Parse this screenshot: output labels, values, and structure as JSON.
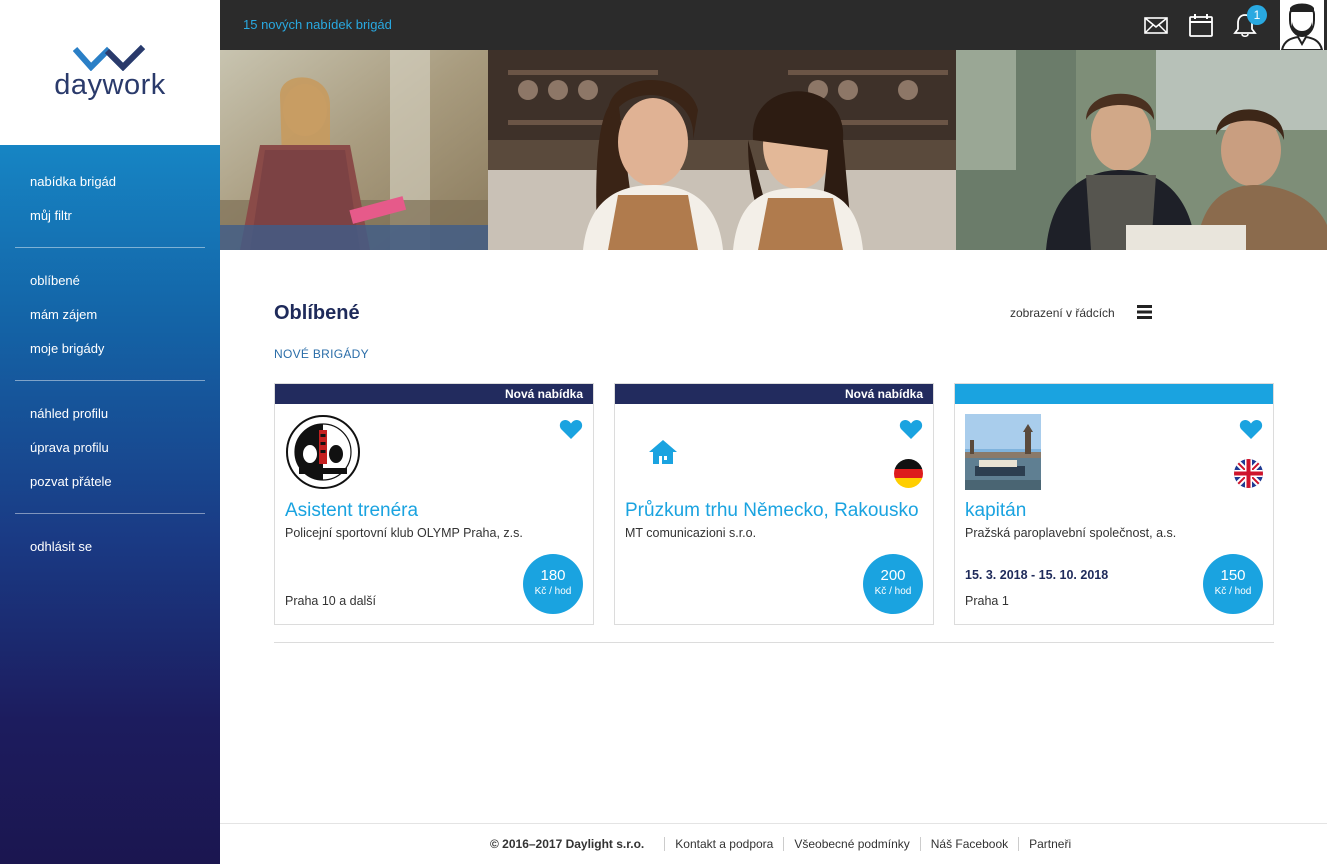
{
  "brand": {
    "name": "daywork"
  },
  "sidebar": {
    "groups": [
      [
        "nabídka brigád",
        "můj filtr"
      ],
      [
        "oblíbené",
        "mám zájem",
        "moje brigády"
      ],
      [
        "náhled profilu",
        "úprava profilu",
        "pozvat přátele"
      ],
      [
        "odhlásit se"
      ]
    ]
  },
  "topbar": {
    "message": "15 nových nabídek brigád",
    "notification_count": "1",
    "icons": [
      "envelope-icon",
      "calendar-icon",
      "bell-icon",
      "avatar-icon"
    ]
  },
  "page": {
    "title": "Oblíbené",
    "view_toggle": "zobrazení v řádcích",
    "section_label": "NOVÉ BRIGÁDY"
  },
  "cards": [
    {
      "badge": "Nová nabídka",
      "title": "Asistent trenéra",
      "company": "Policejní sportovní klub OLYMP Praha, z.s.",
      "date": "",
      "location": "Praha 10 a další",
      "price": "180",
      "unit": "Kč / hod",
      "flag": ""
    },
    {
      "badge": "Nová nabídka",
      "title": "Průzkum trhu Německo, Rakousko",
      "company": "MT comunicazioni s.r.o.",
      "date": "",
      "location": "",
      "price": "200",
      "unit": "Kč / hod",
      "flag": "germany"
    },
    {
      "badge": "",
      "title": "kapitán",
      "company": "Pražská paroplavební společnost, a.s.",
      "date": "15. 3. 2018 - 15. 10. 2018",
      "location": "Praha 1",
      "price": "150",
      "unit": "Kč / hod",
      "flag": "uk"
    }
  ],
  "footer": {
    "copyright": "© 2016–2017 Daylight s.r.o.",
    "links": [
      "Kontakt a podpora",
      "Všeobecné podmínky",
      "Náš Facebook",
      "Partneři"
    ]
  },
  "colors": {
    "accent": "#1aa3e0",
    "navy": "#222b5e",
    "topbar": "#2b2b2b"
  }
}
